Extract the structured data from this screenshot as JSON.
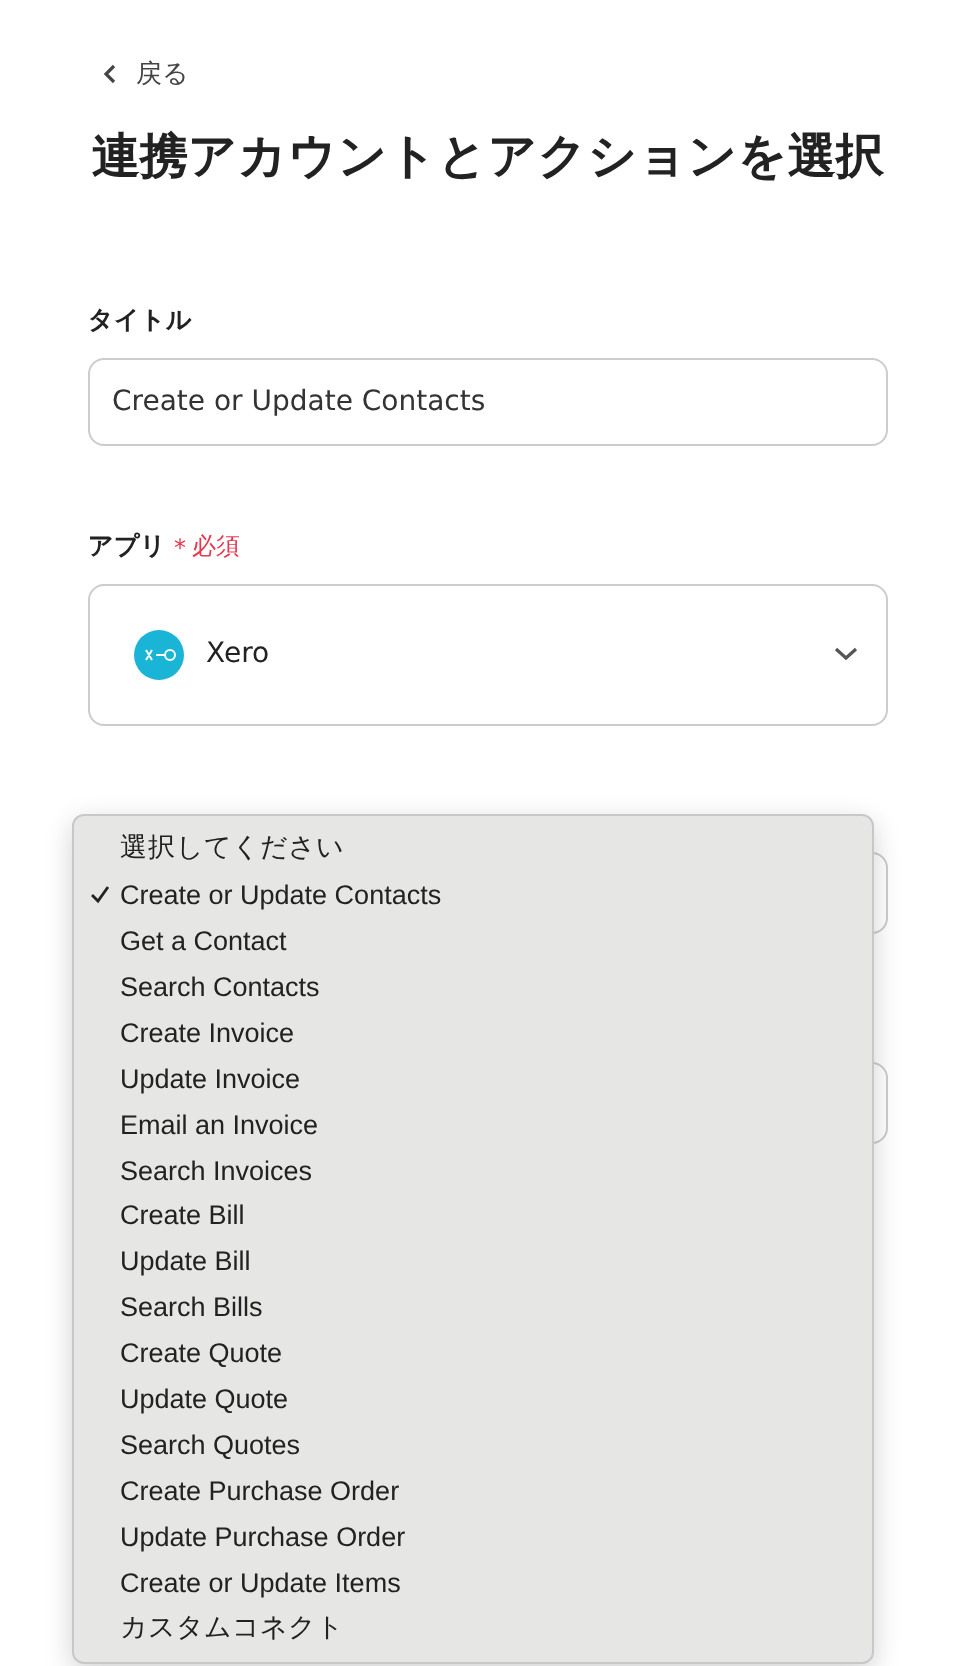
{
  "back_link": {
    "label": "戻る"
  },
  "heading": "連携アカウントとアクションを選択",
  "title_field": {
    "label": "タイトル",
    "value": "Create or Update Contacts"
  },
  "app_field": {
    "label": "アプリ",
    "required_mark": "*",
    "required_text": "必須",
    "value": "Xero"
  },
  "action_menu": {
    "items": [
      {
        "label": "選択してください",
        "selected": false
      },
      {
        "label": "Create or Update Contacts",
        "selected": true
      },
      {
        "label": "Get a Contact",
        "selected": false
      },
      {
        "label": "Search Contacts",
        "selected": false
      },
      {
        "label": "Create Invoice",
        "selected": false
      },
      {
        "label": "Update Invoice",
        "selected": false
      },
      {
        "label": "Email an Invoice",
        "selected": false
      },
      {
        "label": "Search Invoices",
        "selected": false
      },
      {
        "label": "Create Bill",
        "selected": false
      },
      {
        "label": "Update Bill",
        "selected": false
      },
      {
        "label": "Search Bills",
        "selected": false
      },
      {
        "label": "Create Quote",
        "selected": false
      },
      {
        "label": "Update Quote",
        "selected": false
      },
      {
        "label": "Search Quotes",
        "selected": false
      },
      {
        "label": "Create Purchase Order",
        "selected": false
      },
      {
        "label": "Update Purchase Order",
        "selected": false
      },
      {
        "label": "Create or Update Items",
        "selected": false
      },
      {
        "label": "カスタムコネクト",
        "selected": false
      }
    ]
  }
}
